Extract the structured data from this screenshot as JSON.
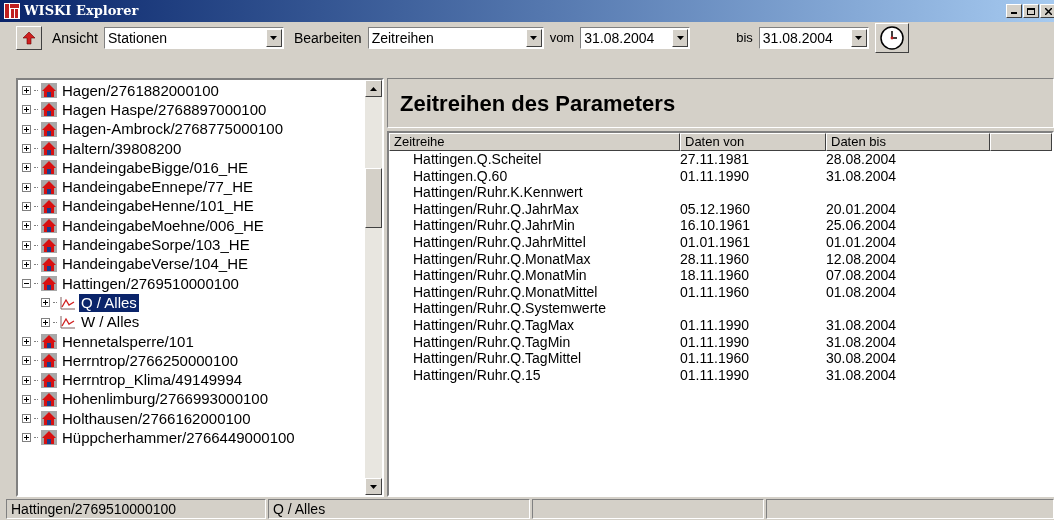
{
  "window": {
    "title": "WISKI Explorer"
  },
  "toolbar": {
    "view_label": "Ansicht",
    "view_value": "Stationen",
    "edit_label": "Bearbeiten",
    "edit_value": "Zeitreihen",
    "from_label": "vom",
    "from_value": "31.08.2004",
    "to_label": "bis",
    "to_value": "31.08.2004"
  },
  "tree": [
    {
      "label": "Hagen/2761882000100",
      "kind": "station",
      "expanded": false,
      "selected": false
    },
    {
      "label": "Hagen Haspe/2768897000100",
      "kind": "station",
      "expanded": false,
      "selected": false
    },
    {
      "label": "Hagen-Ambrock/2768775000100",
      "kind": "station",
      "expanded": false,
      "selected": false
    },
    {
      "label": "Haltern/39808200",
      "kind": "station",
      "expanded": false,
      "selected": false
    },
    {
      "label": "HandeingabeBigge/016_HE",
      "kind": "station",
      "expanded": false,
      "selected": false
    },
    {
      "label": "HandeingabeEnnepe/77_HE",
      "kind": "station",
      "expanded": false,
      "selected": false
    },
    {
      "label": "HandeingabeHenne/101_HE",
      "kind": "station",
      "expanded": false,
      "selected": false
    },
    {
      "label": "HandeingabeMoehne/006_HE",
      "kind": "station",
      "expanded": false,
      "selected": false
    },
    {
      "label": "HandeingabeSorpe/103_HE",
      "kind": "station",
      "expanded": false,
      "selected": false
    },
    {
      "label": "HandeingabeVerse/104_HE",
      "kind": "station",
      "expanded": false,
      "selected": false
    },
    {
      "label": "Hattingen/2769510000100",
      "kind": "station",
      "expanded": true,
      "selected": false,
      "children": [
        {
          "label": "Q / Alles",
          "kind": "series",
          "expanded": false,
          "selected": true
        },
        {
          "label": "W / Alles",
          "kind": "series",
          "expanded": false,
          "selected": false
        }
      ]
    },
    {
      "label": "Hennetalsperre/101",
      "kind": "station",
      "expanded": false,
      "selected": false
    },
    {
      "label": "Herrntrop/2766250000100",
      "kind": "station",
      "expanded": false,
      "selected": false
    },
    {
      "label": "Herrntrop_Klima/49149994",
      "kind": "station",
      "expanded": false,
      "selected": false
    },
    {
      "label": "Hohenlimburg/2766993000100",
      "kind": "station",
      "expanded": false,
      "selected": false
    },
    {
      "label": "Holthausen/2766162000100",
      "kind": "station",
      "expanded": false,
      "selected": false
    },
    {
      "label": "Hüppcherhammer/2766449000100",
      "kind": "station",
      "expanded": false,
      "selected": false
    }
  ],
  "panel": {
    "title": "Zeitreihen des Parameters"
  },
  "table": {
    "columns": [
      "Zeitreihe",
      "Daten von",
      "Daten bis"
    ],
    "rows": [
      [
        "Hattingen.Q.Scheitel",
        "27.11.1981",
        "28.08.2004"
      ],
      [
        "Hattingen.Q.60",
        "01.11.1990",
        "31.08.2004"
      ],
      [
        "Hattingen/Ruhr.K.Kennwert",
        "",
        ""
      ],
      [
        "Hattingen/Ruhr.Q.JahrMax",
        "05.12.1960",
        "20.01.2004"
      ],
      [
        "Hattingen/Ruhr.Q.JahrMin",
        "16.10.1961",
        "25.06.2004"
      ],
      [
        "Hattingen/Ruhr.Q.JahrMittel",
        "01.01.1961",
        "01.01.2004"
      ],
      [
        "Hattingen/Ruhr.Q.MonatMax",
        "28.11.1960",
        "12.08.2004"
      ],
      [
        "Hattingen/Ruhr.Q.MonatMin",
        "18.11.1960",
        "07.08.2004"
      ],
      [
        "Hattingen/Ruhr.Q.MonatMittel",
        "01.11.1960",
        "01.08.2004"
      ],
      [
        "Hattingen/Ruhr.Q.Systemwerte",
        "",
        ""
      ],
      [
        "Hattingen/Ruhr.Q.TagMax",
        "01.11.1990",
        "31.08.2004"
      ],
      [
        "Hattingen/Ruhr.Q.TagMin",
        "01.11.1990",
        "31.08.2004"
      ],
      [
        "Hattingen/Ruhr.Q.TagMittel",
        "01.11.1960",
        "30.08.2004"
      ],
      [
        "Hattingen/Ruhr.Q.15",
        "01.11.1990",
        "31.08.2004"
      ]
    ]
  },
  "status_bar": [
    "Hattingen/2769510000100",
    "Q / Alles"
  ]
}
